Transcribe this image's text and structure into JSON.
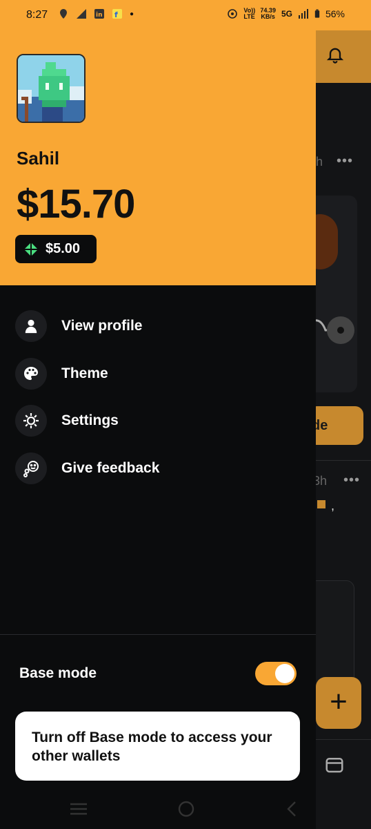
{
  "status_bar": {
    "time": "8:27",
    "network_speed_value": "74.39",
    "network_speed_unit": "KB/s",
    "volte": "Vo)) LTE",
    "network_type": "5G",
    "battery": "56%",
    "icons": [
      "swiggy-icon",
      "signal-icon",
      "linkedin-icon",
      "flipkart-icon",
      "dot-icon",
      "hotspot-icon",
      "signal-bars-icon",
      "battery-icon"
    ]
  },
  "drawer": {
    "username": "Sahil",
    "balance": "$15.70",
    "secondary_balance": "$5.00",
    "menu": [
      {
        "label": "View profile",
        "icon": "person-icon"
      },
      {
        "label": "Theme",
        "icon": "palette-icon"
      },
      {
        "label": "Settings",
        "icon": "gear-icon"
      },
      {
        "label": "Give feedback",
        "icon": "feedback-icon"
      }
    ],
    "base_mode": {
      "label": "Base mode",
      "enabled": true
    },
    "toast": "Turn off Base mode to access your other wallets"
  },
  "background_app": {
    "time_ago_1": "h",
    "time_ago_2": "3h",
    "trade_label": "Trade",
    "comma": ","
  },
  "colors": {
    "accent": "#f9a734",
    "background": "#0b0c0d",
    "menu_icon_bg": "#1c1d20",
    "badge_green": "#4ade80"
  }
}
